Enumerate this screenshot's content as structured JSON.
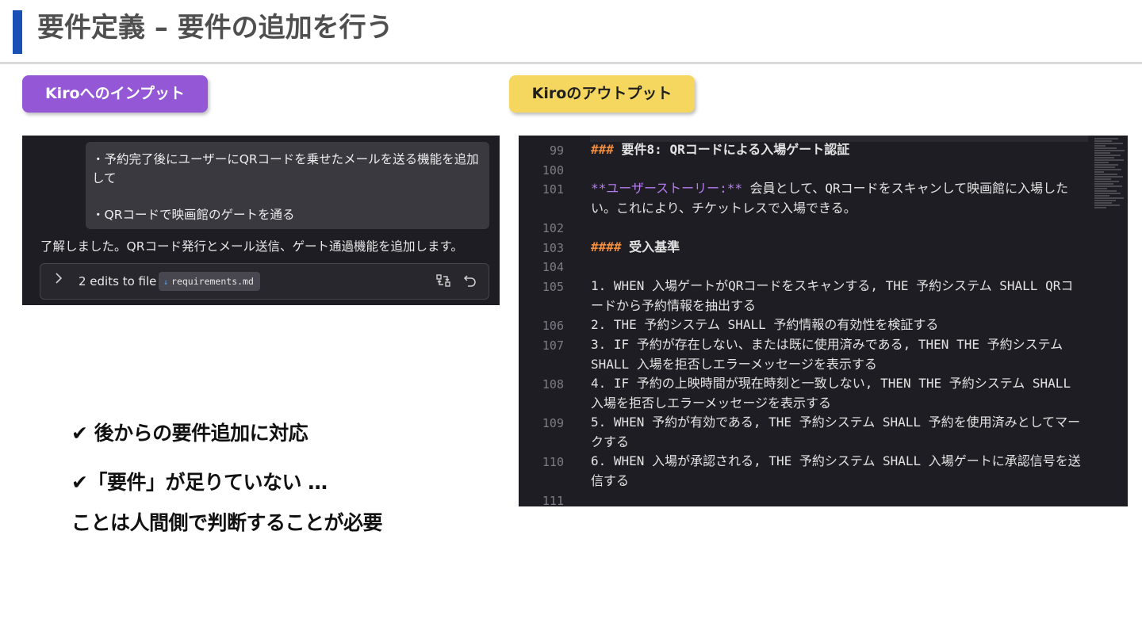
{
  "header": {
    "title": "要件定義 – 要件の追加を行う"
  },
  "tags": {
    "input": "Kiroへのインプット",
    "output": "Kiroのアウトプット"
  },
  "chat": {
    "user_lines": [
      "・予約完了後にユーザーにQRコードを乗せたメールを送る機能を追加して",
      "・QRコードで映画館のゲートを通る"
    ],
    "assistant_reply": "了解しました。QRコード発行とメール送信、ゲート通過機能を追加します。",
    "edits_label": "2 edits to file",
    "file_name": "requirements.md",
    "icons": [
      "chevron-right-icon",
      "markdown-file-icon",
      "compare-icon",
      "undo-icon"
    ]
  },
  "points": {
    "p1": "✔ 後からの要件追加に対応",
    "p2": "✔「要件」が足りていない …",
    "p3": "ことは人間側で判断することが必要"
  },
  "editor": {
    "lines": [
      {
        "num": "99",
        "prefix": "###",
        "text": " 要件8: QRコードによる入場ゲート認証"
      },
      {
        "num": "100",
        "text": ""
      },
      {
        "num": "101",
        "story": "**ユーザーストーリー:**",
        "text": " 会員として、QRコードをスキャンして映画館に入場したい。これにより、チケットレスで入場できる。"
      },
      {
        "num": "102",
        "text": ""
      },
      {
        "num": "103",
        "prefix": "####",
        "text": " 受入基準"
      },
      {
        "num": "104",
        "text": ""
      },
      {
        "num": "105",
        "text": "1. WHEN 入場ゲートがQRコードをスキャンする, THE 予約システム SHALL QRコードから予約情報を抽出する"
      },
      {
        "num": "106",
        "text": "2. THE 予約システム SHALL 予約情報の有効性を検証する"
      },
      {
        "num": "107",
        "text": "3. IF 予約が存在しない、または既に使用済みである, THEN THE 予約システム SHALL 入場を拒否しエラーメッセージを表示する"
      },
      {
        "num": "108",
        "text": "4. IF 予約の上映時間が現在時刻と一致しない, THEN THE 予約システム SHALL 入場を拒否しエラーメッセージを表示する"
      },
      {
        "num": "109",
        "text": "5. WHEN 予約が有効である, THE 予約システム SHALL 予約を使用済みとしてマークする"
      },
      {
        "num": "110",
        "text": "6. WHEN 入場が承認される, THE 予約システム SHALL 入場ゲートに承認信号を送信する"
      },
      {
        "num": "111",
        "text": ""
      }
    ]
  },
  "colors": {
    "title_accent": "#1a4fb5",
    "input_tag": "#9457d6",
    "output_tag": "#f5d65e",
    "panel_bg": "#1e1d23",
    "heading_marker": "#f08d3c",
    "story_marker": "#b77cf0"
  }
}
